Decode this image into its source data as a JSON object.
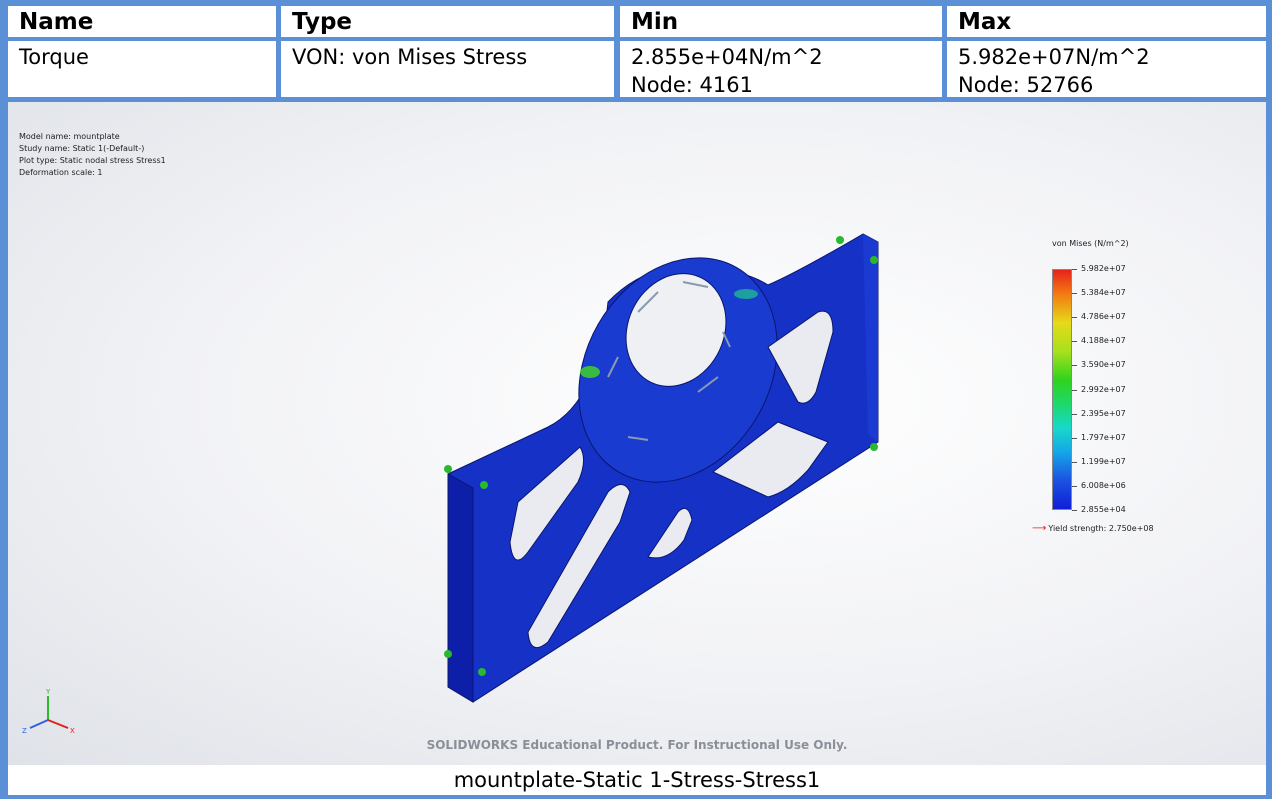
{
  "table": {
    "headers": {
      "name": "Name",
      "type": "Type",
      "min": "Min",
      "max": "Max"
    },
    "row": {
      "name": "Torque",
      "type": "VON: von Mises Stress",
      "min_value": "2.855e+04N/m^2",
      "min_node": "Node: 4161",
      "max_value": "5.982e+07N/m^2",
      "max_node": "Node: 52766"
    }
  },
  "plot": {
    "info": {
      "model": "Model name: mountplate",
      "study": "Study name: Static 1(-Default-)",
      "plot_type": "Plot type: Static nodal stress Stress1",
      "deformation": "Deformation scale: 1"
    },
    "legend": {
      "title": "von Mises (N/m^2)",
      "ticks": [
        "5.982e+07",
        "5.384e+07",
        "4.786e+07",
        "4.188e+07",
        "3.590e+07",
        "2.992e+07",
        "2.395e+07",
        "1.797e+07",
        "1.199e+07",
        "6.008e+06",
        "2.855e+04"
      ],
      "yield": "Yield strength: 2.750e+08"
    },
    "triad": {
      "x": "X",
      "y": "Y",
      "z": "Z"
    },
    "watermark": "SOLIDWORKS Educational Product. For Instructional Use Only."
  },
  "caption": "mountplate-Static 1-Stress-Stress1",
  "colors": {
    "border": "#5b8fd6",
    "mesh_blue": "#1530c8",
    "yield_arrow": "#e0201a"
  }
}
